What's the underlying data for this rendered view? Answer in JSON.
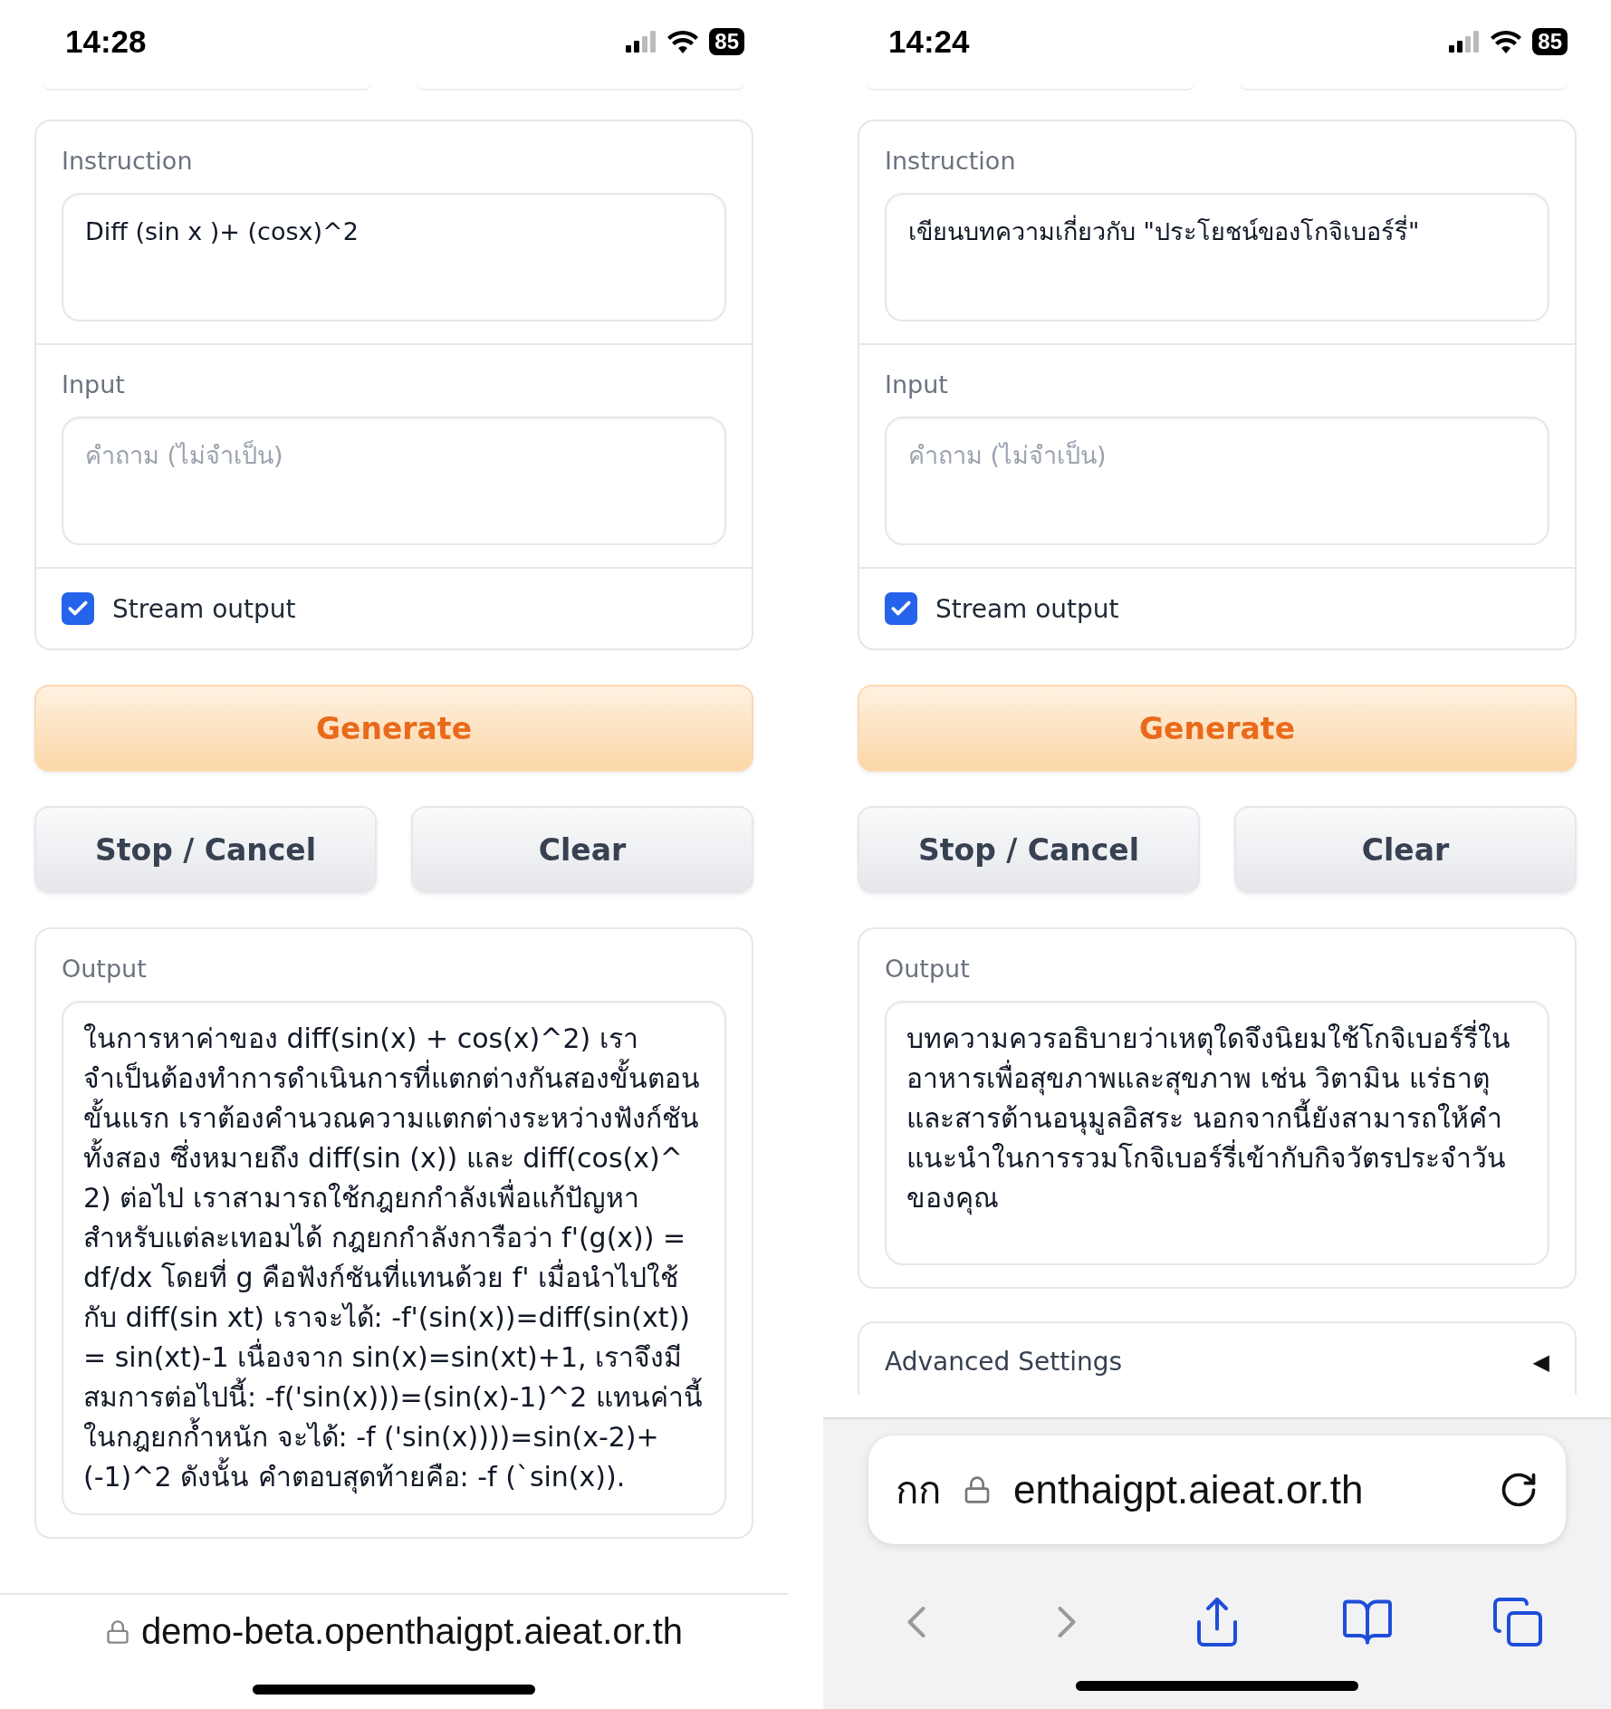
{
  "phones": [
    {
      "status_bar": {
        "time": "14:28",
        "battery": "85"
      },
      "instruction": {
        "label": "Instruction",
        "value": "Diff (sin x )+ (cosx)^2"
      },
      "input": {
        "label": "Input",
        "placeholder": "คำถาม (ไม่จำเป็น)"
      },
      "stream": {
        "label": "Stream output",
        "checked": true
      },
      "generate": "Generate",
      "stop": "Stop / Cancel",
      "clear": "Clear",
      "output": {
        "label": "Output",
        "text": "ในการหาค่าของ diff(sin(x) + cos(x)^2) เราจำเป็นต้องทำการดำเนินการที่แตกต่างกันสองขั้นตอน ขั้นแรก เราต้องคำนวณความแตกต่างระหว่างฟังก์ชันทั้งสอง ซึ่งหมายถึง diff(sin (x)) และ diff(cos(x)^ 2) ต่อไป เราสามารถใช้กฎยกกำลังเพื่อแก้ปัญหาสำหรับแต่ละเทอมได้ กฎยกกำลังการือว่า f'(g(x)) = df/dx โดยที่ g คือฟังก์ชันที่แทนด้วย f' เมื่อนำไปใช้กับ diff(sin xt) เราจะได้: -f'(sin(x))=diff(sin(xt)) = sin(xt)-1 เนื่องจาก sin(x)=sin(xt)+1, เราจึงมีสมการต่อไปนี้: -f('sin(x)))=(sin(x)-1)^2 แทนค่านี้ในกฎยกก้ำหนัก จะได้: -f ('sin(x))))=sin(x-2)+(-1)^2 ดังนั้น คำตอบสุดท้ายคือ: -f (`sin(x))."
      },
      "browser": {
        "kind": "compact",
        "url": "demo-beta.openthaigpt.aieat.or.th"
      }
    },
    {
      "status_bar": {
        "time": "14:24",
        "battery": "85"
      },
      "instruction": {
        "label": "Instruction",
        "value": "เขียนบทความเกี่ยวกับ \"ประโยชน์ของโกจิเบอร์รี่\""
      },
      "input": {
        "label": "Input",
        "placeholder": "คำถาม (ไม่จำเป็น)"
      },
      "stream": {
        "label": "Stream output",
        "checked": true
      },
      "generate": "Generate",
      "stop": "Stop / Cancel",
      "clear": "Clear",
      "output": {
        "label": "Output",
        "text": "บทความควรอธิบายว่าเหตุใดจึงนิยมใช้โกจิเบอร์รี่ในอาหารเพื่อสุขภาพและสุขภาพ เช่น วิตามิน แร่ธาตุ และสารต้านอนุมูลอิสระ นอกจากนี้ยังสามารถให้คำแนะนำในการรวมโกจิเบอร์รี่เข้ากับกิจวัตรประจำวันของคุณ"
      },
      "advanced": {
        "label": "Advanced Settings",
        "arrow": "◀"
      },
      "browser": {
        "kind": "full",
        "text_size": "กก",
        "url": "enthaigpt.aieat.or.th"
      }
    }
  ]
}
